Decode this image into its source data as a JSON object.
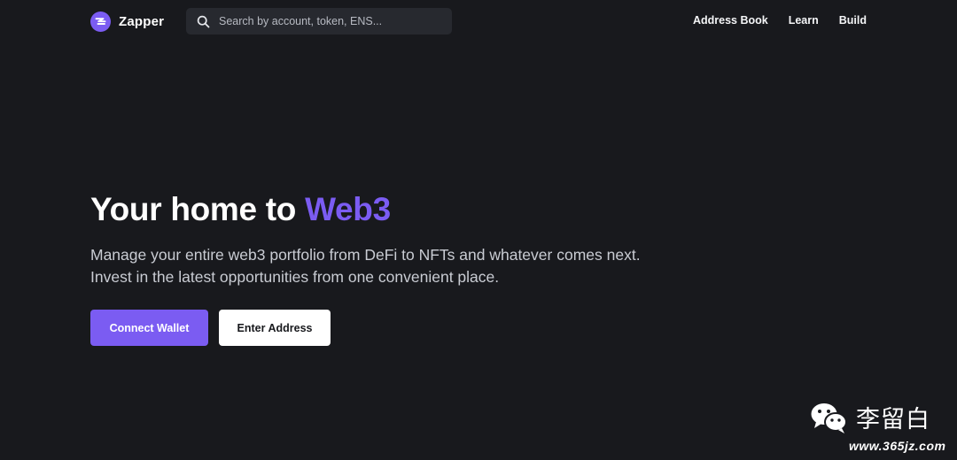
{
  "header": {
    "logo_text": "Zapper",
    "search": {
      "placeholder": "Search by account, token, ENS..."
    },
    "nav": [
      "Address Book",
      "Learn",
      "Build"
    ]
  },
  "hero": {
    "title_main": "Your home to ",
    "title_accent": "Web3",
    "subtitle_line1": "Manage your entire web3 portfolio from DeFi to NFTs and whatever comes next.",
    "subtitle_line2": "Invest in the latest opportunities from one convenient place.",
    "primary_button": "Connect Wallet",
    "secondary_button": "Enter Address"
  },
  "watermark": {
    "name": "李留白",
    "url": "www.365jz.com"
  },
  "colors": {
    "background": "#18191d",
    "accent": "#7b5cf2",
    "search_bg": "#27292f",
    "text_secondary": "#c9ccd3"
  },
  "icons": {
    "logo": "zapper-logo-icon",
    "search": "search-icon",
    "watermark": "wechat-icon"
  }
}
